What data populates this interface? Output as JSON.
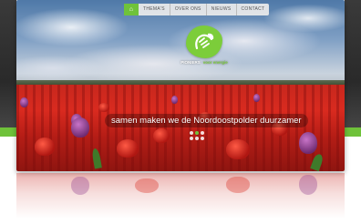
{
  "nav": {
    "home_icon": "house-icon",
    "items": [
      "THEMA'S",
      "OVER ONS",
      "NIEUWS",
      "CONTACT"
    ]
  },
  "logo": {
    "name_primary": "PIONIERS",
    "name_secondary": "voor energie"
  },
  "hero": {
    "tagline": "samen maken we de Noordoostpolder duurzamer"
  },
  "colors": {
    "accent_green": "#6fc23a",
    "tulip_red": "#d92a1f",
    "tulip_purple": "#8e3b8f"
  }
}
